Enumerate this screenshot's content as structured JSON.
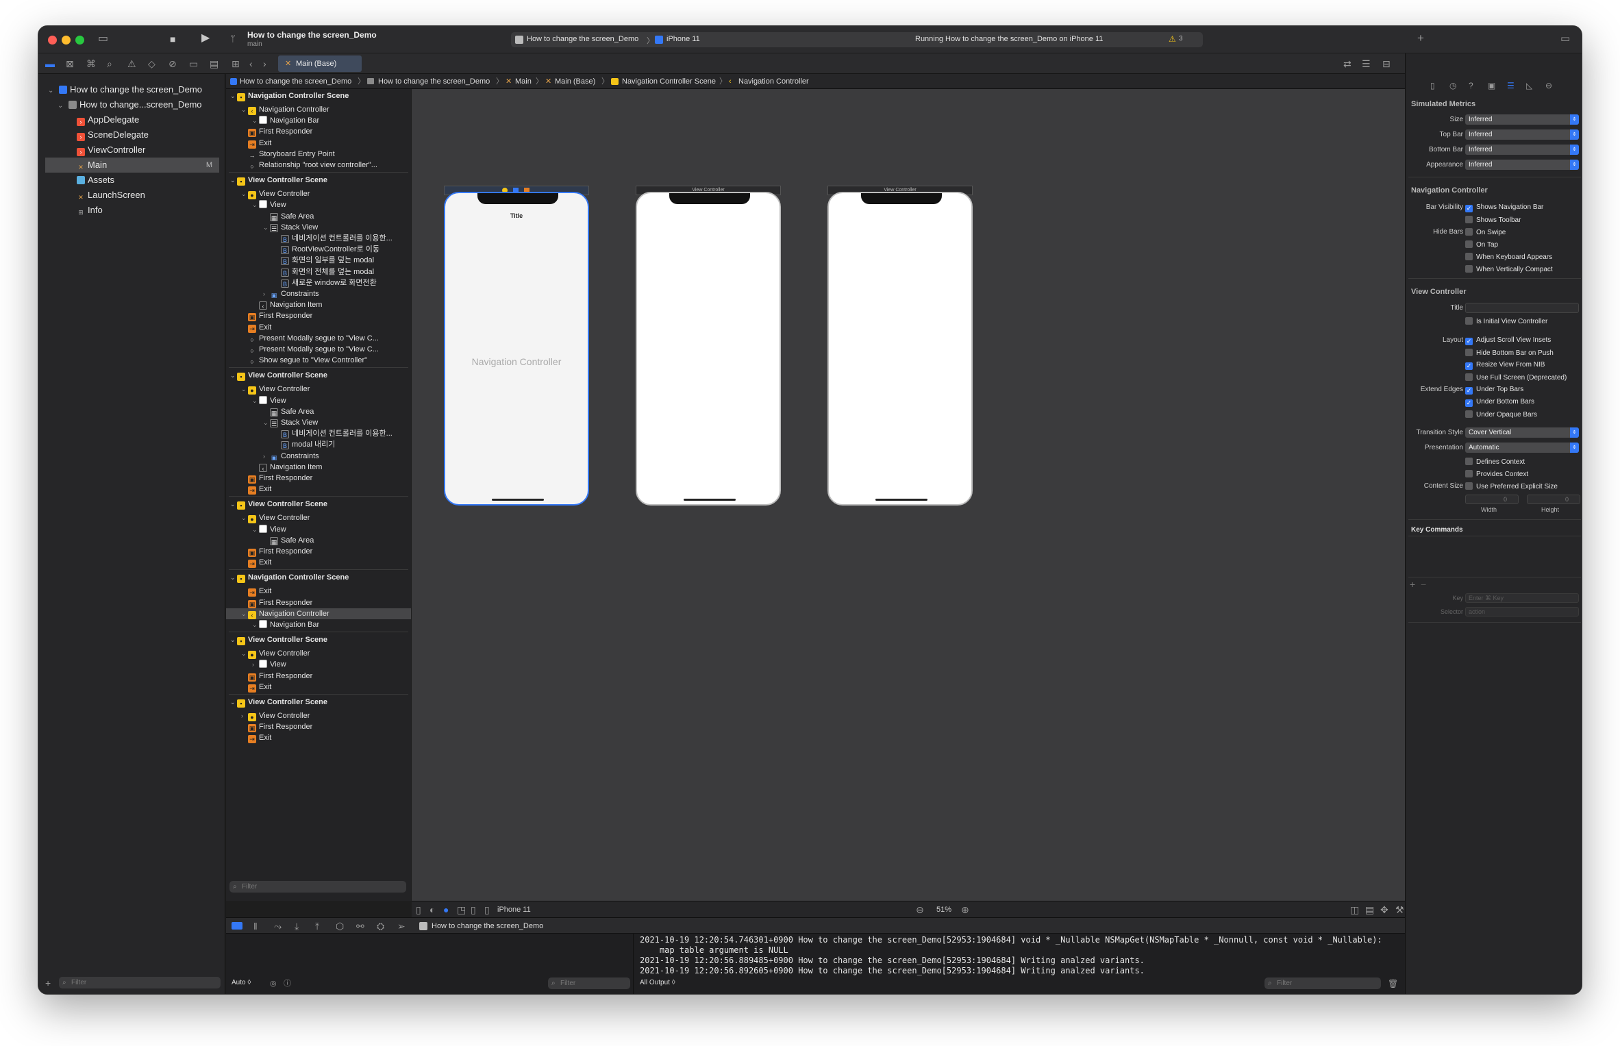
{
  "titlebar": {
    "scheme_title": "How to change the screen_Demo",
    "branch": "main",
    "run_target_app": "How to change the screen_Demo",
    "run_target_device": "iPhone 11",
    "status": "Running How to change the screen_Demo on iPhone 11",
    "warnings": "3"
  },
  "tab": {
    "label": "Main (Base)"
  },
  "breadcrumb": [
    "How to change the screen_Demo",
    "How to change the screen_Demo",
    "Main",
    "Main (Base)",
    "Navigation Controller Scene",
    "Navigation Controller"
  ],
  "navigator": {
    "items": [
      {
        "label": "How to change the screen_Demo",
        "icon": "project-icon"
      },
      {
        "label": "How to change...screen_Demo",
        "icon": "folder-icon"
      },
      {
        "label": "AppDelegate",
        "icon": "swift-icon"
      },
      {
        "label": "SceneDelegate",
        "icon": "swift-icon"
      },
      {
        "label": "ViewController",
        "icon": "swift-icon"
      },
      {
        "label": "Main",
        "icon": "storyboard-icon",
        "badge": "M"
      },
      {
        "label": "Assets",
        "icon": "assets-icon"
      },
      {
        "label": "LaunchScreen",
        "icon": "storyboard-icon"
      },
      {
        "label": "Info",
        "icon": "plist-icon"
      }
    ],
    "filter_placeholder": "Filter"
  },
  "outline": [
    {
      "label": "Navigation Controller Scene",
      "type": "scene"
    },
    {
      "label": "Navigation Controller",
      "type": "navctl"
    },
    {
      "label": "Navigation Bar",
      "type": "view"
    },
    {
      "label": "First Responder",
      "type": "responder"
    },
    {
      "label": "Exit",
      "type": "exit"
    },
    {
      "label": "Storyboard Entry Point",
      "type": "arrow"
    },
    {
      "label": "Relationship \"root view controller\"...",
      "type": "segue"
    },
    {
      "label": "View Controller Scene",
      "type": "scene"
    },
    {
      "label": "View Controller",
      "type": "vc"
    },
    {
      "label": "View",
      "type": "view"
    },
    {
      "label": "Safe Area",
      "type": "safe"
    },
    {
      "label": "Stack View",
      "type": "stack"
    },
    {
      "label": "네비게이션 컨트롤러를 이용한...",
      "type": "button"
    },
    {
      "label": "RootViewController로 이동",
      "type": "button"
    },
    {
      "label": "화면의 일부를 덮는 modal",
      "type": "button"
    },
    {
      "label": "화면의 전체를 덮는 modal",
      "type": "button"
    },
    {
      "label": "새로운 window로 화면전환",
      "type": "button"
    },
    {
      "label": "Constraints",
      "type": "constraints"
    },
    {
      "label": "Navigation Item",
      "type": "navitem"
    },
    {
      "label": "First Responder",
      "type": "responder"
    },
    {
      "label": "Exit",
      "type": "exit"
    },
    {
      "label": "Present Modally segue to \"View C...",
      "type": "segue"
    },
    {
      "label": "Present Modally segue to \"View C...",
      "type": "segue"
    },
    {
      "label": "Show segue to \"View Controller\"",
      "type": "segue"
    },
    {
      "label": "View Controller Scene",
      "type": "scene"
    },
    {
      "label": "View Controller",
      "type": "vc"
    },
    {
      "label": "View",
      "type": "view"
    },
    {
      "label": "Safe Area",
      "type": "safe"
    },
    {
      "label": "Stack View",
      "type": "stack"
    },
    {
      "label": "네비게이션 컨트롤러를 이용한...",
      "type": "button"
    },
    {
      "label": "modal 내리기",
      "type": "button"
    },
    {
      "label": "Constraints",
      "type": "constraints"
    },
    {
      "label": "Navigation Item",
      "type": "navitem"
    },
    {
      "label": "First Responder",
      "type": "responder"
    },
    {
      "label": "Exit",
      "type": "exit"
    },
    {
      "label": "View Controller Scene",
      "type": "scene"
    },
    {
      "label": "View Controller",
      "type": "vc"
    },
    {
      "label": "View",
      "type": "view"
    },
    {
      "label": "Safe Area",
      "type": "safe"
    },
    {
      "label": "First Responder",
      "type": "responder"
    },
    {
      "label": "Exit",
      "type": "exit"
    },
    {
      "label": "Navigation Controller Scene",
      "type": "scene"
    },
    {
      "label": "Exit",
      "type": "exit"
    },
    {
      "label": "First Responder",
      "type": "responder"
    },
    {
      "label": "Navigation Controller",
      "type": "navctl",
      "selected": true
    },
    {
      "label": "Navigation Bar",
      "type": "view"
    },
    {
      "label": "View Controller Scene",
      "type": "scene"
    },
    {
      "label": "View Controller",
      "type": "vc"
    },
    {
      "label": "View",
      "type": "view"
    },
    {
      "label": "First Responder",
      "type": "responder"
    },
    {
      "label": "Exit",
      "type": "exit"
    },
    {
      "label": "View Controller Scene",
      "type": "scene"
    },
    {
      "label": "View Controller",
      "type": "vc"
    },
    {
      "label": "First Responder",
      "type": "responder"
    },
    {
      "label": "Exit",
      "type": "exit"
    }
  ],
  "outline_filter_placeholder": "Filter",
  "canvas": {
    "phone1_title": "Title",
    "phone1_label": "Navigation Controller",
    "phone2_tag": "View Controller",
    "phone3_tag": "View Controller"
  },
  "canvasbar": {
    "device": "iPhone 11",
    "zoom": "51%"
  },
  "debug": {
    "process": "How to change the screen_Demo"
  },
  "variables": {
    "mode": "Auto ◊",
    "filter_placeholder": "Filter"
  },
  "console": {
    "lines": [
      "2021-10-19 12:20:54.746301+0900 How to change the screen_Demo[52953:1904684] void * _Nullable NSMapGet(NSMapTable * _Nonnull, const void * _Nullable):",
      "    map table argument is NULL",
      "2021-10-19 12:20:56.889485+0900 How to change the screen_Demo[52953:1904684] Writing analzed variants.",
      "2021-10-19 12:20:56.892605+0900 How to change the screen_Demo[52953:1904684] Writing analzed variants."
    ],
    "output_mode": "All Output ◊",
    "filter_placeholder": "Filter"
  },
  "inspector": {
    "simulated_metrics": {
      "header": "Simulated Metrics",
      "rows": [
        {
          "label": "Size",
          "value": "Inferred"
        },
        {
          "label": "Top Bar",
          "value": "Inferred"
        },
        {
          "label": "Bottom Bar",
          "value": "Inferred"
        },
        {
          "label": "Appearance",
          "value": "Inferred"
        }
      ]
    },
    "navigation_controller": {
      "header": "Navigation Controller",
      "bar_visibility_label": "Bar Visibility",
      "hide_bars_label": "Hide Bars",
      "options": [
        {
          "label": "Shows Navigation Bar",
          "checked": true
        },
        {
          "label": "Shows Toolbar",
          "checked": false
        },
        {
          "label": "On Swipe",
          "checked": false
        },
        {
          "label": "On Tap",
          "checked": false
        },
        {
          "label": "When Keyboard Appears",
          "checked": false
        },
        {
          "label": "When Vertically Compact",
          "checked": false
        }
      ]
    },
    "view_controller": {
      "header": "View Controller",
      "title_label": "Title",
      "title_value": "",
      "is_initial": {
        "label": "Is Initial View Controller",
        "checked": false
      },
      "layout_label": "Layout",
      "layout": [
        {
          "label": "Adjust Scroll View Insets",
          "checked": true
        },
        {
          "label": "Hide Bottom Bar on Push",
          "checked": false
        },
        {
          "label": "Resize View From NIB",
          "checked": true
        },
        {
          "label": "Use Full Screen (Deprecated)",
          "checked": false
        }
      ],
      "extend_edges_label": "Extend Edges",
      "extend_edges": [
        {
          "label": "Under Top Bars",
          "checked": true
        },
        {
          "label": "Under Bottom Bars",
          "checked": true
        },
        {
          "label": "Under Opaque Bars",
          "checked": false
        }
      ],
      "transition_style_label": "Transition Style",
      "transition_style": "Cover Vertical",
      "presentation_label": "Presentation",
      "presentation": "Automatic",
      "defines_context": {
        "label": "Defines Context",
        "checked": false
      },
      "provides_context": {
        "label": "Provides Context",
        "checked": false
      },
      "content_size_label": "Content Size",
      "use_preferred": {
        "label": "Use Preferred Explicit Size",
        "checked": false
      },
      "width_value": "0",
      "height_value": "0",
      "width_label": "Width",
      "height_label": "Height"
    },
    "key_commands": {
      "header": "Key Commands",
      "key_label": "Key",
      "key_placeholder": "Enter ⌘ Key",
      "selector_label": "Selector",
      "selector_placeholder": "action"
    }
  },
  "colors": {
    "accent": "#3478f6",
    "swift": "#f05138",
    "storyboard": "#e6a34a",
    "scene": "#f5c518"
  }
}
